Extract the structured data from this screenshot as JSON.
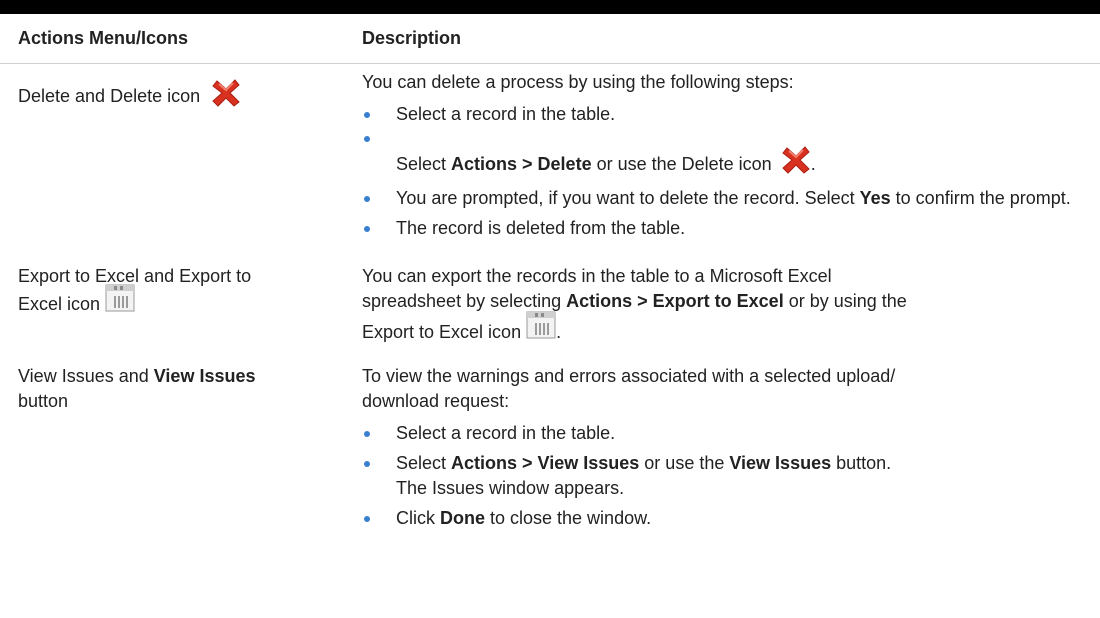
{
  "header": {
    "col1": "Actions Menu/Icons",
    "col2": "Description"
  },
  "rows": [
    {
      "action": "Delete and Delete icon",
      "icon": "delete-x-icon",
      "intro": "You can delete a process by using the following steps:",
      "steps": [
        {
          "text": "Select a record in the table."
        },
        {
          "pre": "Select ",
          "bold": "Actions > Delete",
          "post": " or use the Delete icon",
          "end": "."
        },
        {
          "pre": "You are prompted, if you want to delete the record. Select ",
          "bold": "Yes",
          "post": " to confirm the prompt."
        },
        {
          "text": "The record is deleted from the table."
        }
      ]
    },
    {
      "action_line1": "Export to Excel and Export to",
      "action_line2": "Excel icon",
      "icon": "excel-export-icon",
      "desc_pre": "You can export the records in the table to a Microsoft Excel spreadsheet by selecting ",
      "desc_bold": "Actions > Export to Excel",
      "desc_post": " or by using the",
      "desc_line3": "Export to Excel icon",
      "desc_end": "."
    },
    {
      "action_pre": "View Issues and ",
      "action_bold": "View Issues",
      "action_line2": "button",
      "intro": "To view the warnings and errors associated with a selected upload/ download request:",
      "steps": [
        {
          "text": "Select a record in the table."
        },
        {
          "pre": "Select ",
          "bold": "Actions > View Issues",
          "mid": " or use the ",
          "bold2": "View Issues",
          "post": " button.",
          "line2": "The Issues window appears."
        },
        {
          "pre": "Click ",
          "bold": "Done",
          "post": " to close the window."
        }
      ]
    }
  ],
  "colors": {
    "bullet": "#3a7fcf",
    "delete_icon": "#d9311f",
    "rule": "#000000"
  }
}
